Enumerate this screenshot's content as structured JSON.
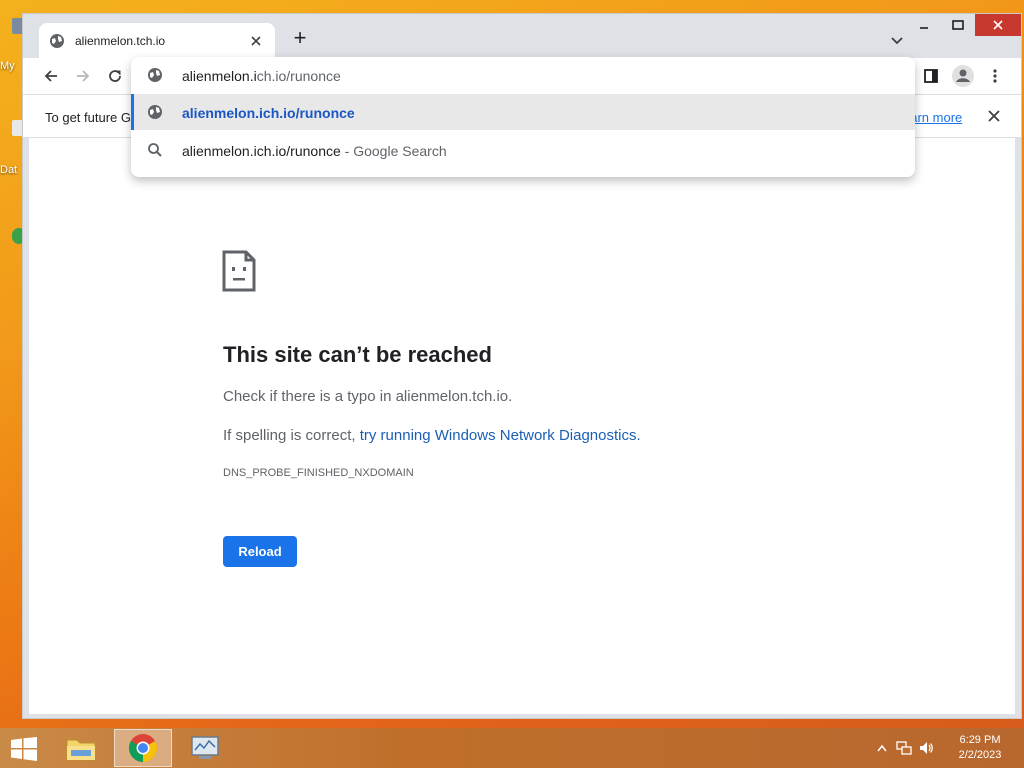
{
  "desktop": {
    "icon_labels": [
      "My",
      "Dat"
    ]
  },
  "browser": {
    "tab": {
      "title": "alienmelon.tch.io",
      "close_icon": "close-icon"
    },
    "new_tab_symbol": "+",
    "omnibox": {
      "typed_prefix": "alienmelon.i",
      "typed_rest": "ch.io/runonce",
      "suggestions": [
        {
          "icon": "globe-icon",
          "text": "alienmelon.ich.io/runonce"
        },
        {
          "icon": "search-icon",
          "text": "alienmelon.ich.io/runonce",
          "suffix": " - Google Search"
        }
      ]
    },
    "infobar": {
      "text": "To get future G",
      "link": "earn more"
    }
  },
  "error_page": {
    "title": "This site can’t be reached",
    "line1": "Check if there is a typo in alienmelon.tch.io.",
    "line2_prefix": "If spelling is correct, ",
    "line2_link": "try running Windows Network Diagnostics.",
    "code": "DNS_PROBE_FINISHED_NXDOMAIN",
    "reload_label": "Reload"
  },
  "taskbar": {
    "time": "6:29 PM",
    "date": "2/2/2023"
  },
  "colors": {
    "accent": "#1a73e8",
    "window_close": "#c7392e"
  }
}
